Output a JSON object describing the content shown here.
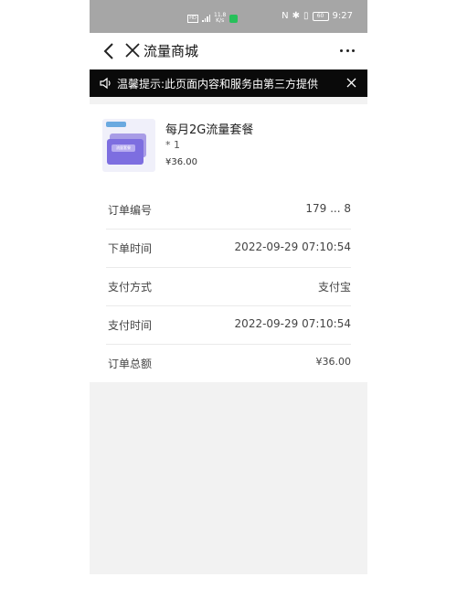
{
  "status_bar": {
    "net_speed_top": "11.8",
    "net_speed_bottom": "K/s",
    "battery": "60",
    "time": "9:27"
  },
  "header": {
    "title": "流量商城"
  },
  "notice": {
    "text": "温馨提示:此页面内容和服务由第三方提供"
  },
  "product": {
    "name": "每月2G流量套餐",
    "quantity": "* 1",
    "price": "¥36.00",
    "thumb_label": "流量套餐"
  },
  "order": {
    "rows": [
      {
        "label": "订单编号",
        "value": "179 ... 8"
      },
      {
        "label": "下单时间",
        "value": "2022-09-29 07:10:54"
      },
      {
        "label": "支付方式",
        "value": "支付宝"
      },
      {
        "label": "支付时间",
        "value": "2022-09-29 07:10:54"
      },
      {
        "label": "订单总额",
        "value": "¥36.00"
      }
    ]
  },
  "colors": {
    "status_bar": "#a6a6a6",
    "notice_bg": "#0a0a0a",
    "page_bg": "#f2f2f2",
    "wechat_green": "#27c05a",
    "thumb_purple": "#7d6ee0"
  }
}
